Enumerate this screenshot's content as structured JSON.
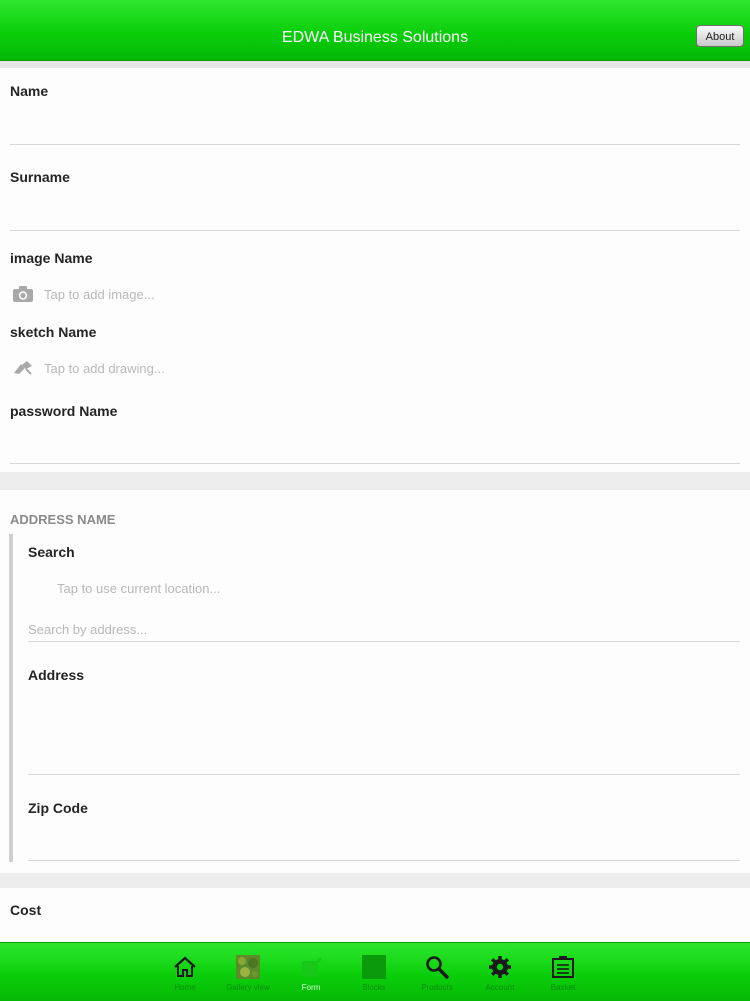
{
  "header": {
    "title": "EDWA Business Solutions",
    "about_label": "About"
  },
  "form": {
    "name_label": "Name",
    "surname_label": "Surname",
    "image_label": "image Name",
    "image_hint": "Tap to add image...",
    "sketch_label": "sketch Name",
    "sketch_hint": "Tap to add drawing...",
    "password_label": "password Name"
  },
  "address": {
    "section_title": "ADDRESS NAME",
    "search_label": "Search",
    "location_hint": "Tap to use current location...",
    "search_placeholder": "Search by address...",
    "address_label": "Address",
    "zip_label": "Zip Code"
  },
  "cost": {
    "label": "Cost"
  },
  "tabbar": {
    "items": [
      {
        "label": "Home",
        "icon": "home-icon"
      },
      {
        "label": "Gallery view",
        "icon": "gallery-icon"
      },
      {
        "label": "Form",
        "icon": "form-icon",
        "active": true
      },
      {
        "label": "Blocks",
        "icon": "blocks-icon"
      },
      {
        "label": "Products",
        "icon": "search-icon"
      },
      {
        "label": "Account",
        "icon": "gear-icon"
      },
      {
        "label": "Basket",
        "icon": "basket-icon"
      }
    ]
  },
  "colors": {
    "bar_green": "#0bcf0b",
    "active_tab": "#d8ffd8"
  }
}
